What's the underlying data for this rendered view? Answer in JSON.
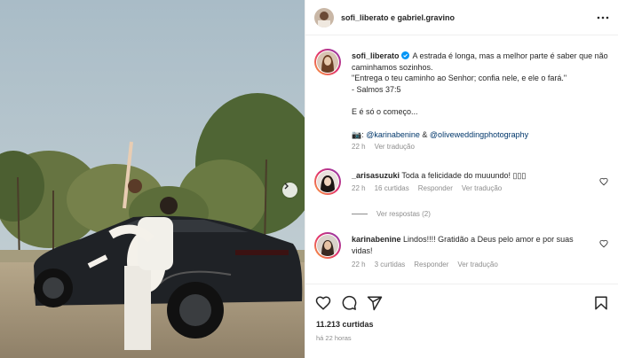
{
  "header": {
    "title": "sofi_liberato e gabriel.gravino"
  },
  "caption": {
    "username": "sofi_liberato",
    "line1": " A estrada é longa, mas a melhor parte é saber que não caminhamos sozinhos.",
    "line2": "\"Entrega o teu caminho ao Senhor; confia nele, e ele o fará.\"",
    "line3": "- Salmos 37:5",
    "line4": "E é só o começo...",
    "credit_prefix": "📷: ",
    "mention1": "@karinabenine",
    "amp": " & ",
    "mention2": "@oliveweddingphotography",
    "time": "22 h",
    "translate": "Ver tradução"
  },
  "comments": [
    {
      "username": "_arisasuzuki",
      "text": "Toda a felicidade do muuundo! ▯▯▯",
      "time": "22 h",
      "likes": "16 curtidas",
      "reply": "Responder",
      "translate": "Ver tradução"
    },
    {
      "username": "karinabenine",
      "text": "Lindos!!!! Gratidão a Deus pelo amor e por suas vidas!",
      "time": "22 h",
      "likes": "3 curtidas",
      "reply": "Responder",
      "translate": "Ver tradução"
    }
  ],
  "replies_label": "Ver respostas (2)",
  "footer": {
    "likes": "11.213 curtidas",
    "time": "há 22 horas"
  },
  "colors": {
    "link": "#00376b",
    "verified": "#0095f6",
    "muted": "#8e8e8e"
  }
}
